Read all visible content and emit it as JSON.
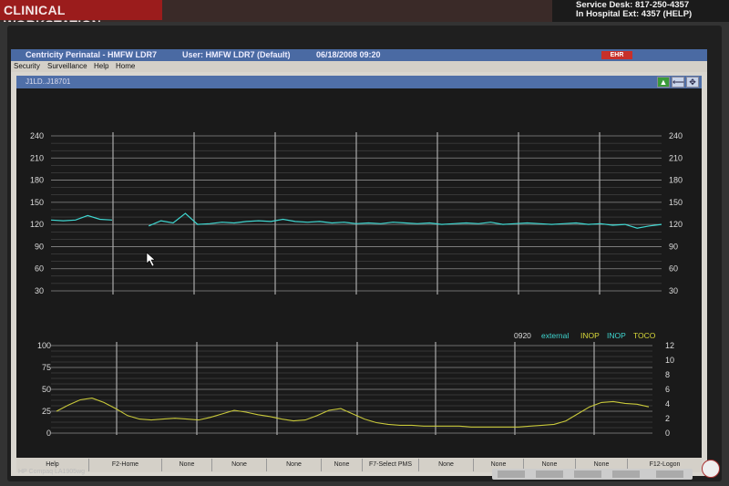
{
  "sign_left": "CLINICAL WORKSTATION",
  "sign_right": {
    "line1": "Service Desk: 817-250-4357",
    "line2": "In Hospital Ext: 4357 (HELP)"
  },
  "window": {
    "app_title": "Centricity Perinatal - HMFW LDR7",
    "user": "User: HMFW LDR7 (Default)",
    "timestamp": "06/18/2008 09:20",
    "ehr_badge": "EHR"
  },
  "menu": [
    "Security",
    "Surveillance",
    "Help",
    "Home"
  ],
  "panel_title": "J1LD..J18701",
  "fhr_axis": {
    "labels": [
      "240",
      "210",
      "180",
      "150",
      "120",
      "90",
      "60",
      "30"
    ]
  },
  "toco_axis": {
    "left_labels": [
      "100",
      "75",
      "50",
      "25",
      "0"
    ],
    "right_labels": [
      "12",
      "10",
      "8",
      "6",
      "4",
      "2",
      "0"
    ]
  },
  "status_line": {
    "time": "0920",
    "source": "external",
    "inop1": "INOP",
    "inop2": "INOP",
    "toco": "TOCO"
  },
  "function_keys": [
    "Help",
    "F2-Home",
    "None",
    "None",
    "None",
    "None",
    "F7-Select PMS",
    "None",
    "None",
    "None",
    "None",
    "F12-Logon"
  ],
  "monitor_brand": "HP Compaq LA1905wg",
  "colors": {
    "fhr_trace": "#3fd6d0",
    "toco_trace": "#c8c83a",
    "status_cyan": "#3fd6d0",
    "status_yellow": "#d8d83a"
  },
  "chart_data": [
    {
      "type": "line",
      "title": "",
      "ylabel": "",
      "ylim": [
        30,
        240
      ],
      "yticks": [
        240,
        210,
        180,
        150,
        120,
        90,
        60,
        30
      ],
      "series": [
        {
          "x": [
            0,
            2,
            4,
            6,
            8,
            10,
            12,
            14,
            16,
            18,
            20,
            22,
            24,
            26,
            28,
            30,
            32,
            34,
            36,
            38,
            40,
            42,
            44,
            46,
            48,
            50,
            52,
            54,
            56,
            58,
            60,
            62,
            64,
            66,
            68,
            70,
            72,
            74,
            76,
            78,
            80,
            82,
            84,
            86,
            88,
            90,
            92,
            94,
            96,
            98,
            100
          ],
          "values": [
            126,
            125,
            126,
            132,
            127,
            126,
            null,
            null,
            118,
            125,
            122,
            135,
            120,
            121,
            123,
            122,
            124,
            125,
            124,
            127,
            124,
            123,
            124,
            122,
            123,
            121,
            122,
            121,
            123,
            122,
            121,
            122,
            120,
            121,
            122,
            121,
            123,
            120,
            121,
            122,
            121,
            120,
            121,
            122,
            120,
            121,
            119,
            120,
            115,
            118,
            120
          ]
        }
      ]
    },
    {
      "type": "line",
      "title": "",
      "ylim": [
        0,
        100
      ],
      "yticks": [
        100,
        75,
        50,
        25,
        0
      ],
      "series": [
        {
          "x": [
            0,
            2,
            4,
            6,
            8,
            10,
            12,
            14,
            16,
            18,
            20,
            22,
            24,
            26,
            28,
            30,
            32,
            34,
            36,
            38,
            40,
            42,
            44,
            46,
            48,
            50,
            52,
            54,
            56,
            58,
            60,
            62,
            64,
            66,
            68,
            70,
            72,
            74,
            76,
            78,
            80,
            82,
            84,
            86,
            88,
            90,
            92,
            94,
            96,
            98,
            100
          ],
          "values": [
            25,
            32,
            38,
            40,
            35,
            28,
            20,
            16,
            15,
            16,
            17,
            16,
            15,
            18,
            22,
            26,
            24,
            21,
            19,
            16,
            14,
            15,
            20,
            26,
            28,
            22,
            16,
            12,
            10,
            9,
            9,
            8,
            8,
            8,
            8,
            7,
            7,
            7,
            7,
            7,
            8,
            9,
            10,
            14,
            22,
            30,
            35,
            36,
            34,
            33,
            30
          ]
        }
      ]
    }
  ]
}
